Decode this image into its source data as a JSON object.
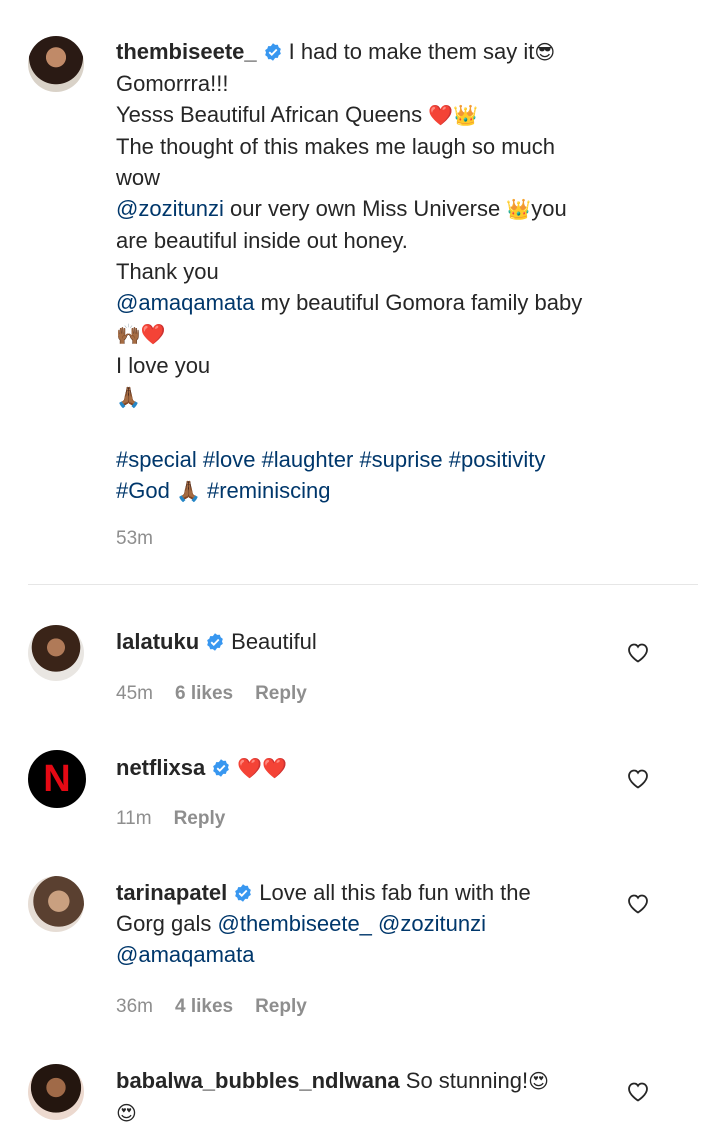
{
  "caption": {
    "username": "thembiseete_",
    "lines": {
      "l1": "I had to make them say it",
      "l2": "Gomorrra!!!",
      "l3": "Yesss Beautiful African Queens ",
      "l4": "The thought of this makes me laugh so much",
      "l5": "wow",
      "l6_mention": "@zozitunzi",
      "l6_rest": " our very own Miss Universe ",
      "l6_end": "you",
      "l7": "are beautiful inside out honey.",
      "l8": "Thank you",
      "l9_mention": "@amaqamata",
      "l9_rest": " my beautiful Gomora family baby",
      "l11": "I love you"
    },
    "hashtags": {
      "h1": "#special",
      "h2": "#love",
      "h3": "#laughter",
      "h4": "#suprise",
      "h5": "#positivity",
      "h6": "#God",
      "h7": "#reminiscing"
    },
    "time": "53m",
    "emoji": {
      "sunglasses": "😎",
      "heart": "❤️",
      "crown": "👑",
      "hands": "🙌🏾",
      "pray": "🙏🏾",
      "heart_eyes": "😍"
    }
  },
  "comments": [
    {
      "username": "lalatuku",
      "text": "Beautiful",
      "time": "45m",
      "likes": "6 likes",
      "reply": "Reply"
    },
    {
      "username": "netflixsa",
      "text": "❤️❤️",
      "time": "11m",
      "reply": "Reply",
      "avatar_letter": "N"
    },
    {
      "username": "tarinapatel",
      "text_line1": "Love all this fab fun with the",
      "text_line2_pre": "Gorg gals ",
      "mention1": "@thembiseete_",
      "mention2": "@zozitunzi",
      "mention3": "@amaqamata",
      "time": "36m",
      "likes": "4 likes",
      "reply": "Reply"
    },
    {
      "username": "babalwa_bubbles_ndlwana",
      "text": "So stunning!",
      "emoji": "😍"
    }
  ],
  "colors": {
    "mention": "#00376b",
    "meta": "#8e8e8e",
    "verified": "#3897f0"
  }
}
